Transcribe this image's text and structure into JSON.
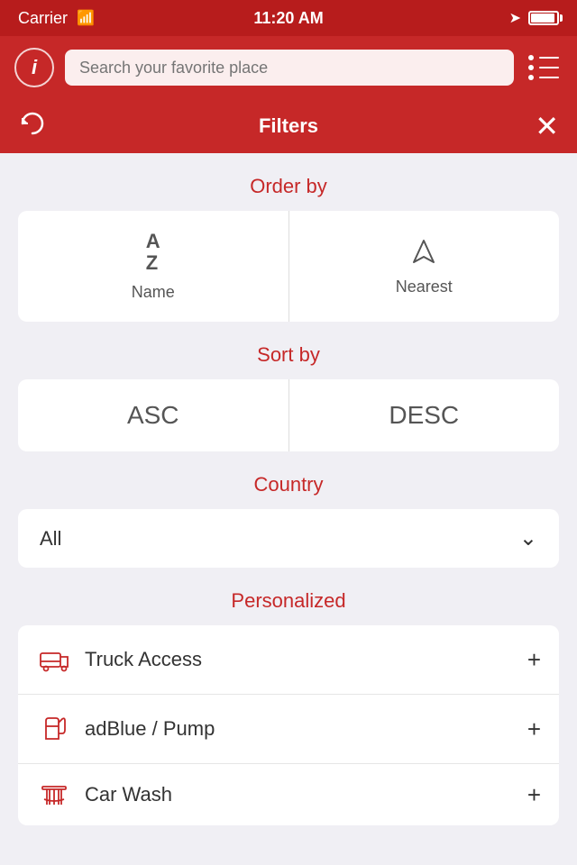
{
  "statusBar": {
    "carrier": "Carrier",
    "time": "11:20 AM",
    "signalIcon": "wifi-icon",
    "locationIcon": "location-arrow-icon",
    "batteryIcon": "battery-icon"
  },
  "header": {
    "infoIcon": "info-icon",
    "searchPlaceholder": "Search your favorite place",
    "menuIcon": "menu-icon"
  },
  "filtersBar": {
    "refreshIcon": "refresh-icon",
    "title": "Filters",
    "closeIcon": "close-icon"
  },
  "orderBy": {
    "sectionLabel": "Order by",
    "options": [
      {
        "id": "name",
        "label": "Name",
        "iconType": "az"
      },
      {
        "id": "nearest",
        "label": "Nearest",
        "iconType": "arrow"
      }
    ]
  },
  "sortBy": {
    "sectionLabel": "Sort by",
    "options": [
      {
        "id": "asc",
        "label": "ASC"
      },
      {
        "id": "desc",
        "label": "DESC"
      }
    ]
  },
  "country": {
    "sectionLabel": "Country",
    "selectedValue": "All",
    "chevronIcon": "chevron-down-icon"
  },
  "personalized": {
    "sectionLabel": "Personalized",
    "items": [
      {
        "id": "truck-access",
        "label": "Truck Access",
        "iconType": "truck"
      },
      {
        "id": "adblue-pump",
        "label": "adBlue / Pump",
        "iconType": "fuel-nozzle"
      },
      {
        "id": "car-wash",
        "label": "Car Wash",
        "iconType": "car-wash"
      }
    ]
  }
}
